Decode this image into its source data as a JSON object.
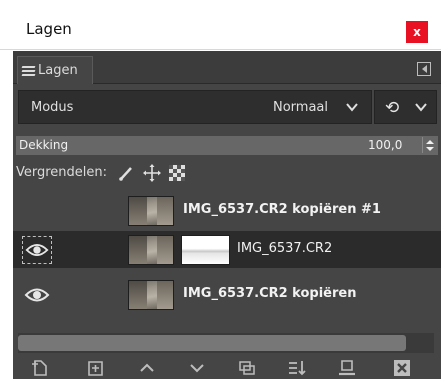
{
  "window": {
    "title": "Lagen",
    "close_label": "x"
  },
  "tabs": [
    {
      "label": "Lagen",
      "icon": "layers-icon"
    }
  ],
  "mode": {
    "label": "Modus",
    "value": "Normaal",
    "composite_icon": "⟲"
  },
  "opacity": {
    "label": "Dekking",
    "value": "100,0",
    "fraction": 1.0
  },
  "lock": {
    "label": "Vergrendelen:",
    "icons": [
      "lock-pixels-icon",
      "lock-position-icon",
      "lock-alpha-icon"
    ]
  },
  "layers": [
    {
      "name": "IMG_6537.CR2 kopiëren #1",
      "visible": false,
      "selected": false,
      "has_mask": false,
      "bold": true
    },
    {
      "name": "IMG_6537.CR2",
      "visible": true,
      "selected": true,
      "has_mask": true,
      "bold": false
    },
    {
      "name": "IMG_6537.CR2 kopiëren",
      "visible": true,
      "selected": false,
      "has_mask": false,
      "bold": true
    }
  ],
  "toolbar": [
    "new-layer-icon",
    "new-layer-group-icon",
    "raise-layer-icon",
    "lower-layer-icon",
    "duplicate-layer-icon",
    "merge-layer-icon",
    "anchor-layer-icon",
    "delete-layer-icon"
  ],
  "colors": {
    "panel": "#454545",
    "selected_row": "#2b2b2b",
    "close": "#e81123"
  }
}
